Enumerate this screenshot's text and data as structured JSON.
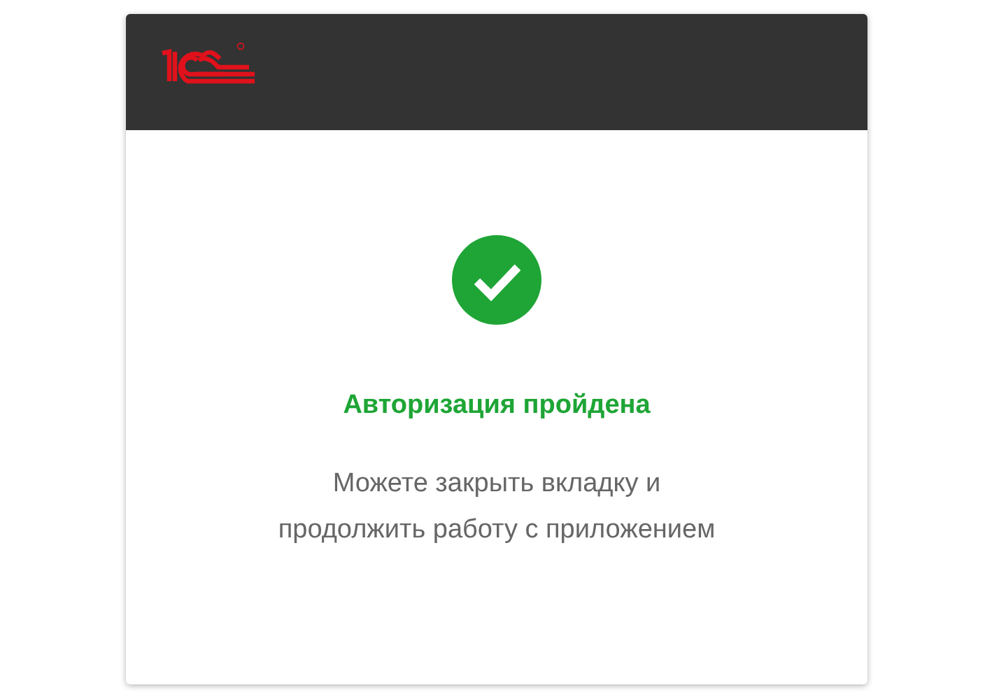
{
  "status": {
    "success": true,
    "title": "Авторизация пройдена",
    "message_lines": [
      "Можете закрыть вкладку и",
      "продолжить работу с приложением"
    ]
  }
}
